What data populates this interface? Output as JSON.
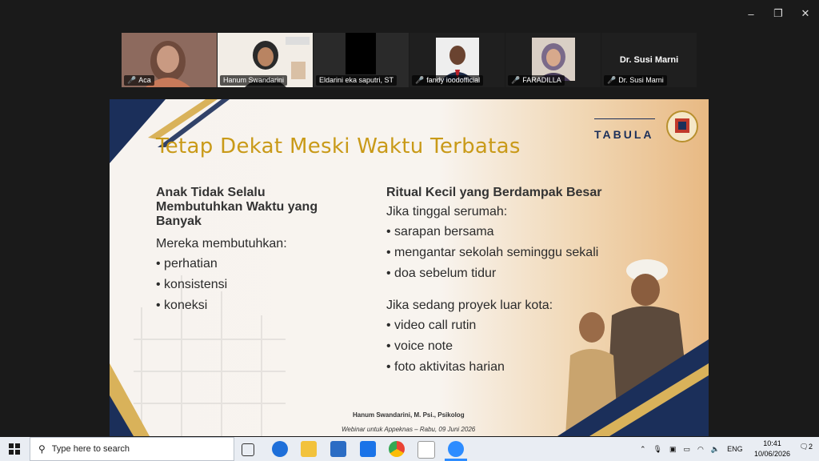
{
  "window": {
    "controls": [
      "–",
      "❐",
      "✕"
    ]
  },
  "participants": [
    {
      "name": "Aca",
      "muted": true
    },
    {
      "name": "Hanum Swandarini",
      "muted": false
    },
    {
      "name": "Eldarini eka saputri, ST",
      "muted": false
    },
    {
      "name": "fandy ioodofficial",
      "muted": true
    },
    {
      "name": "FARADILLA",
      "muted": true
    },
    {
      "name": "Dr. Susi Marni",
      "muted": true,
      "title": "Dr. Susi Marni"
    }
  ],
  "slide": {
    "title": "Tetap Dekat Meski Waktu Terbatas",
    "brand": "TABULA",
    "left": {
      "heading": "Anak Tidak Selalu Membutuhkan Waktu yang Banyak",
      "intro": "Mereka membutuhkan:",
      "bullets": [
        "perhatian",
        "konsistensi",
        "koneksi"
      ]
    },
    "right": {
      "heading": "Ritual Kecil yang Berdampak Besar",
      "intro1": "Jika tinggal serumah:",
      "bullets1": [
        "sarapan bersama",
        "mengantar sekolah seminggu sekali",
        "doa sebelum tidur"
      ],
      "intro2": "Jika sedang proyek luar kota:",
      "bullets2": [
        "video call rutin",
        "voice note",
        "foto aktivitas harian"
      ]
    },
    "footer_name": "Hanum Swandarini, M. Psi., Psikolog",
    "footer_event": "Webinar untuk Appeknas – Rabu, 09 Juni 2026"
  },
  "taskbar": {
    "search_placeholder": "Type here to search",
    "lang": "ENG",
    "time": "10:41",
    "date": "10/06/2026",
    "notifications": "2"
  }
}
